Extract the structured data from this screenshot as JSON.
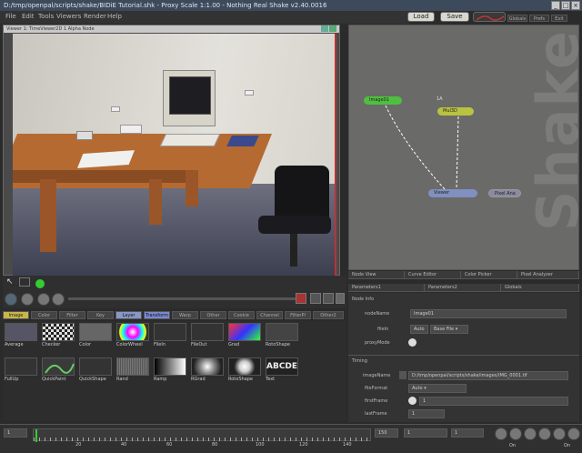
{
  "window": {
    "title": "D:/tmp/openpal/scripts/shake/BIDiE Tutorial.shk - Proxy Scale 1:1.00 - Nothing Real Shake v2.40.0016"
  },
  "menu": [
    "File",
    "Edit",
    "Tools",
    "Viewers",
    "Render",
    "Help"
  ],
  "top_buttons": {
    "load": "Load",
    "save": "Save",
    "globals": "Globals",
    "prefs": "Prefs",
    "exit": "Exit"
  },
  "viewer": {
    "title": "Viewer 1: TimeViewer2D 1 Alpha Node"
  },
  "nodes": [
    {
      "label": "Image01",
      "color": "#4fbf3f"
    },
    {
      "label": "Mul3D",
      "color": "#b8c340"
    },
    {
      "label": "Viewer",
      "color": "#8090c0"
    },
    {
      "label": "Pixel Ana",
      "color": "#8a8aa0"
    }
  ],
  "node_annotation": "1A",
  "lower_tabs": [
    "Node View",
    "Curve Editor",
    "Color Picker",
    "Pixel Analyzer"
  ],
  "param_tabs": [
    "Parameters1",
    "Parameters2",
    "Globals"
  ],
  "params_section1": {
    "heading": "Node Info",
    "rows": [
      {
        "label": "nodeName",
        "value": "Image01"
      },
      {
        "label": "fileIn",
        "value": "Auto"
      },
      {
        "label": "proxyMode",
        "value": ""
      }
    ],
    "dropdown_value": "Base File"
  },
  "params_section2": {
    "heading": "Timing",
    "rows": [
      {
        "label": "imageName",
        "value": "D:/tmp/openpal/scripts/shake/images/IMG_0001.tif"
      },
      {
        "label": "fileFormat",
        "value": "Auto"
      },
      {
        "label": "firstFrame",
        "value": "1"
      },
      {
        "label": "lastFrame",
        "value": "1"
      }
    ]
  },
  "toolbox_tabs": [
    "Image",
    "Color",
    "Filter",
    "Key",
    "Layer",
    "Transform",
    "Warp",
    "Other",
    "Cookie",
    "Channel",
    "FilterPl",
    "Other2"
  ],
  "tools": [
    {
      "label": "Average"
    },
    {
      "label": "Checker"
    },
    {
      "label": "Color"
    },
    {
      "label": "ColorWheel"
    },
    {
      "label": "FileIn"
    },
    {
      "label": "FileOut"
    },
    {
      "label": "Grad"
    },
    {
      "label": "RotoShape"
    },
    {
      "label": "FullUp"
    },
    {
      "label": "QuickPaint"
    },
    {
      "label": "QuickShape"
    },
    {
      "label": "Rand"
    },
    {
      "label": "Ramp"
    },
    {
      "label": "RGrad"
    },
    {
      "label": "RotoShape"
    },
    {
      "label": "Text"
    }
  ],
  "timeline": {
    "start": "1",
    "end": "150",
    "current": "1",
    "incr": "1",
    "ticks": [
      "20",
      "40",
      "60",
      "80",
      "100",
      "120",
      "140"
    ],
    "stop_label": "On",
    "play_label": "On"
  },
  "text_tool_sample": "ABCDE"
}
